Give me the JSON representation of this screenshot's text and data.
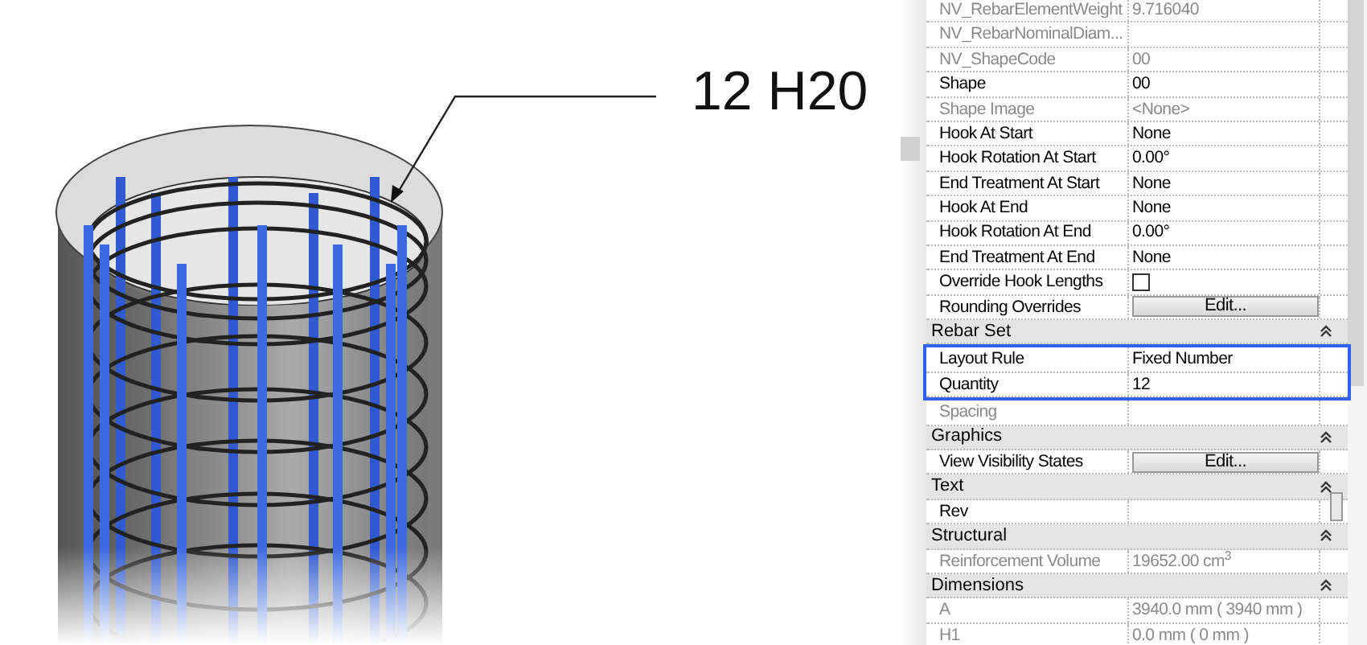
{
  "annotation": {
    "label": "12 H20"
  },
  "properties": {
    "rows": [
      {
        "kind": "text",
        "label": "NV_RebarElementWeight",
        "value": "9.716040",
        "disabled": true,
        "highlighted": false
      },
      {
        "kind": "text",
        "label": "NV_RebarNominalDiam...",
        "disabled": true,
        "highlighted": false
      },
      {
        "kind": "text",
        "label": "NV_ShapeCode",
        "value": "00",
        "disabled": true,
        "highlighted": false
      },
      {
        "kind": "text",
        "label": "Shape",
        "value": "00",
        "disabled": false,
        "highlighted": false
      },
      {
        "kind": "text",
        "label": "Shape Image",
        "value": "<None>",
        "disabled": true,
        "highlighted": false
      },
      {
        "kind": "text",
        "label": "Hook At Start",
        "value": "None",
        "disabled": false,
        "highlighted": false
      },
      {
        "kind": "text",
        "label": "Hook Rotation At Start",
        "value": "0.00°",
        "disabled": false,
        "highlighted": false
      },
      {
        "kind": "text",
        "label": "End Treatment At Start",
        "value": "None",
        "disabled": false,
        "highlighted": false
      },
      {
        "kind": "text",
        "label": "Hook At End",
        "value": "None",
        "disabled": false,
        "highlighted": false
      },
      {
        "kind": "text",
        "label": "Hook Rotation At End",
        "value": "0.00°",
        "disabled": false,
        "highlighted": false
      },
      {
        "kind": "text",
        "label": "End Treatment At End",
        "value": "None",
        "disabled": false,
        "highlighted": false
      },
      {
        "kind": "checkbox",
        "label": "Override Hook Lengths",
        "checked": false,
        "disabled": false,
        "highlighted": false
      },
      {
        "kind": "button",
        "label": "Rounding Overrides",
        "value": "Edit...",
        "disabled": false,
        "highlighted": false
      },
      {
        "kind": "header",
        "label": "Rebar Set",
        "expanded": true
      },
      {
        "kind": "text",
        "label": "Layout Rule",
        "value": "Fixed Number",
        "disabled": false,
        "highlighted": true
      },
      {
        "kind": "text",
        "label": "Quantity",
        "value": "12",
        "disabled": false,
        "highlighted": true
      },
      {
        "kind": "text",
        "label": "Spacing",
        "disabled": true,
        "highlighted": false
      },
      {
        "kind": "header",
        "label": "Graphics",
        "expanded": true
      },
      {
        "kind": "button",
        "label": "View Visibility States",
        "value": "Edit...",
        "disabled": false,
        "highlighted": false
      },
      {
        "kind": "header",
        "label": "Text",
        "expanded": true
      },
      {
        "kind": "text",
        "label": "Rev",
        "disabled": false,
        "highlighted": false
      },
      {
        "kind": "header",
        "label": "Structural",
        "expanded": true
      },
      {
        "kind": "text",
        "label": "Reinforcement Volume",
        "value": "19652.00 cm$^{3}$",
        "disabled": true,
        "highlighted": false
      },
      {
        "kind": "header",
        "label": "Dimensions",
        "expanded": true
      },
      {
        "kind": "text",
        "label": "A",
        "value": "3940.0 mm ( 3940 mm )",
        "disabled": true,
        "highlighted": false
      },
      {
        "kind": "text",
        "label": "H1",
        "value": "0.0 mm ( 0 mm )",
        "disabled": true,
        "highlighted": false
      }
    ]
  }
}
